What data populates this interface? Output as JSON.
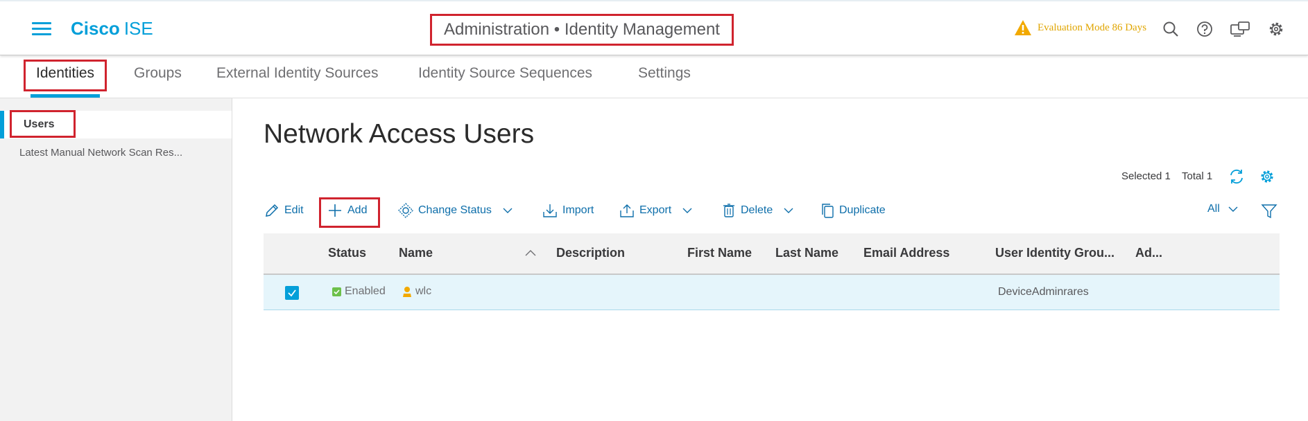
{
  "header": {
    "brand_name": "Cisco",
    "product_name": "ISE",
    "page_heading": "Administration • Identity Management",
    "eval_text": "Evaluation Mode 86 Days",
    "icons": [
      "menu-icon",
      "warning-icon",
      "search-icon",
      "help-icon",
      "notifications-icon",
      "settings-icon"
    ]
  },
  "tabs": [
    {
      "label": "Identities",
      "active": true
    },
    {
      "label": "Groups",
      "active": false
    },
    {
      "label": "External Identity Sources",
      "active": false
    },
    {
      "label": "Identity Source Sequences",
      "active": false
    },
    {
      "label": "Settings",
      "active": false
    }
  ],
  "sidebar": {
    "items": [
      {
        "label": "Users",
        "active": true
      },
      {
        "label": "Latest Manual Network Scan Res...",
        "active": false
      }
    ]
  },
  "main": {
    "title": "Network Access Users",
    "selected_text": "Selected 1",
    "total_text": "Total 1",
    "filter_value": "All",
    "toolbar": {
      "edit": "Edit",
      "add": "Add",
      "change_status": "Change Status",
      "import": "Import",
      "export": "Export",
      "delete": "Delete",
      "duplicate": "Duplicate"
    }
  },
  "table": {
    "columns": [
      "Status",
      "Name",
      "Description",
      "First Name",
      "Last Name",
      "Email Address",
      "User Identity Grou...",
      "Ad..."
    ],
    "rows": [
      {
        "selected": true,
        "status": "Enabled",
        "name": "wlc",
        "description": "",
        "first_name": "",
        "last_name": "",
        "email": "",
        "group": "DeviceAdminrares",
        "admin": ""
      }
    ]
  },
  "colors": {
    "accent": "#049fd9",
    "highlight_box": "#d0232e",
    "warning": "#e0a500",
    "link": "#0d6eaa",
    "selected_row": "#e5f5fb"
  }
}
